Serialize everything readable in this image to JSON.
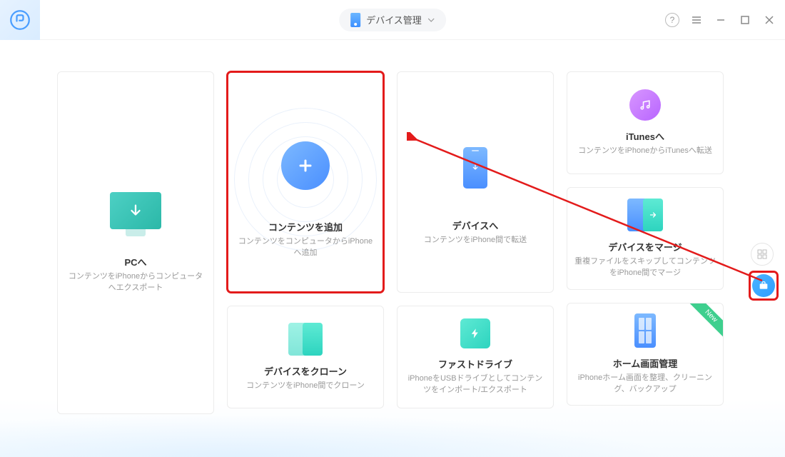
{
  "header": {
    "dropdown_label": "デバイス管理"
  },
  "cards": {
    "pc": {
      "title": "PCへ",
      "desc": "コンテンツをiPhoneからコンピュータへエクスポート"
    },
    "add": {
      "title": "コンテンツを追加",
      "desc": "コンテンツをコンピュータからiPhoneへ追加"
    },
    "device": {
      "title": "デバイスへ",
      "desc": "コンテンツをiPhone間で転送"
    },
    "itunes": {
      "title": "iTunesへ",
      "desc": "コンテンツをiPhoneからiTunesへ転送"
    },
    "merge": {
      "title": "デバイスをマージ",
      "desc": "重複ファイルをスキップしてコンテンツをiPhone間でマージ"
    },
    "clone": {
      "title": "デバイスをクローン",
      "desc": "コンテンツをiPhone間でクローン"
    },
    "drive": {
      "title": "ファストドライブ",
      "desc": "iPhoneをUSBドライブとしてコンテンツをインポート/エクスポート"
    },
    "home": {
      "title": "ホーム画面管理",
      "desc": "iPhoneホーム画面を整理、クリーニング、バックアップ",
      "ribbon": "New"
    }
  }
}
